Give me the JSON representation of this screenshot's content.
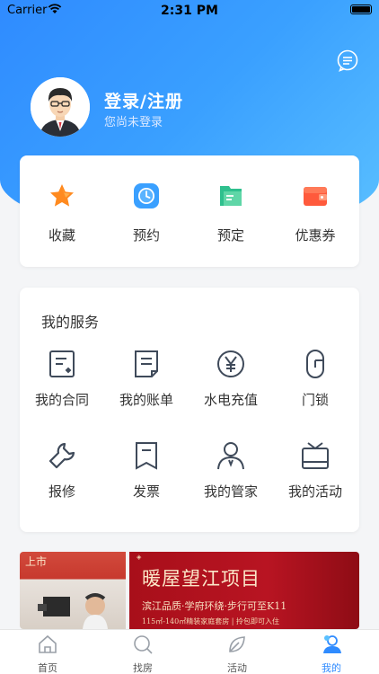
{
  "status_bar": {
    "carrier": "Carrier",
    "time": "2:31 PM"
  },
  "profile": {
    "login_title": "登录/注册",
    "login_subtitle": "您尚未登录",
    "avatar_icon": "avatar-icon"
  },
  "quick_actions": [
    {
      "label": "收藏",
      "icon": "star-icon",
      "color": "#ff8a1f"
    },
    {
      "label": "预约",
      "icon": "clock-icon",
      "color": "#3aa0ff"
    },
    {
      "label": "预定",
      "icon": "folder-icon",
      "color": "#2fc08e"
    },
    {
      "label": "优惠券",
      "icon": "wallet-icon",
      "color": "#ff5a3c"
    }
  ],
  "services": {
    "title": "我的服务",
    "items": [
      {
        "label": "我的合同",
        "icon": "contract-icon"
      },
      {
        "label": "我的账单",
        "icon": "bill-icon"
      },
      {
        "label": "水电充值",
        "icon": "yen-icon"
      },
      {
        "label": "门锁",
        "icon": "lock-icon"
      },
      {
        "label": "报修",
        "icon": "wrench-icon"
      },
      {
        "label": "发票",
        "icon": "invoice-icon"
      },
      {
        "label": "我的管家",
        "icon": "person-icon"
      },
      {
        "label": "我的活动",
        "icon": "gift-icon"
      }
    ]
  },
  "banner": {
    "title": "暖屋望江项目",
    "line1": "滨江品质·学府环绕·步行可至K11",
    "line2": "115㎡-140㎡精装家庭套房 | 拎包即可入住",
    "left_text": "上市"
  },
  "tabbar": [
    {
      "label": "首页",
      "icon": "home-icon",
      "active": false
    },
    {
      "label": "找房",
      "icon": "search-icon",
      "active": false
    },
    {
      "label": "活动",
      "icon": "leaf-icon",
      "active": false
    },
    {
      "label": "我的",
      "icon": "profile-icon",
      "active": true
    }
  ],
  "colors": {
    "primary": "#2f8bff",
    "icon_gray": "#3f4a5a"
  }
}
